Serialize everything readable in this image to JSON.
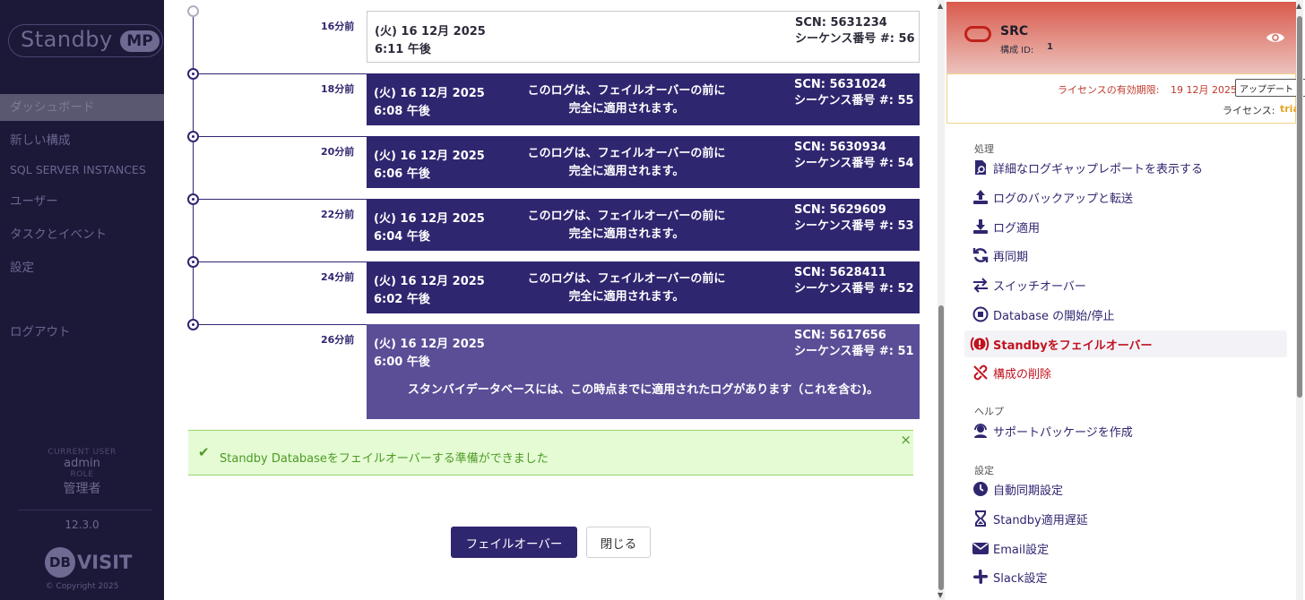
{
  "sidebar": {
    "logo_text": "Standby",
    "logo_badge": "MP",
    "nav": [
      {
        "label": "ダッシュボード"
      },
      {
        "label": "新しい構成"
      },
      {
        "label": "SQL SERVER INSTANCES"
      },
      {
        "label": "ユーザー"
      },
      {
        "label": "タスクとイベント"
      },
      {
        "label": "設定"
      },
      {
        "label": "ログアウト"
      }
    ],
    "current_user_label": "CURRENT USER",
    "current_user": "admin",
    "role_label": "ROLE",
    "role": "管理者",
    "version": "12.3.0",
    "brand_mark": "DB",
    "brand_text": "VISIT",
    "copyright": "© Copyright 2025"
  },
  "timeline": {
    "entries": [
      {
        "ago": "16分前",
        "date": "(火) 16 12月 2025",
        "time": "6:11 午後",
        "note": "",
        "scn": "SCN: 5631234",
        "seq": "シーケンス番号 #: 56",
        "style": "plain"
      },
      {
        "ago": "18分前",
        "date": "(火) 16 12月 2025",
        "time": "6:08 午後",
        "note1": "このログは、フェイルオーバーの前に",
        "note2": "完全に適用されます。",
        "scn": "SCN: 5631024",
        "seq": "シーケンス番号 #: 55",
        "style": "dark"
      },
      {
        "ago": "20分前",
        "date": "(火) 16 12月 2025",
        "time": "6:06 午後",
        "note1": "このログは、フェイルオーバーの前に",
        "note2": "完全に適用されます。",
        "scn": "SCN: 5630934",
        "seq": "シーケンス番号 #: 54",
        "style": "dark"
      },
      {
        "ago": "22分前",
        "date": "(火) 16 12月 2025",
        "time": "6:04 午後",
        "note1": "このログは、フェイルオーバーの前に",
        "note2": "完全に適用されます。",
        "scn": "SCN: 5629609",
        "seq": "シーケンス番号 #: 53",
        "style": "dark"
      },
      {
        "ago": "24分前",
        "date": "(火) 16 12月 2025",
        "time": "6:02 午後",
        "note1": "このログは、フェイルオーバーの前に",
        "note2": "完全に適用されます。",
        "scn": "SCN: 5628411",
        "seq": "シーケンス番号 #: 52",
        "style": "dark"
      },
      {
        "ago": "26分前",
        "date": "(火) 16 12月 2025",
        "time": "6:00 午後",
        "scn": "SCN: 5617656",
        "seq": "シーケンス番号 #: 51",
        "footer": "スタンバイデータベースには、この時点までに適用されたログがあります（これを含む)。",
        "style": "light"
      }
    ]
  },
  "alert": {
    "message": "Standby Databaseをフェイルオーバーする準備ができました",
    "close": "×"
  },
  "buttons": {
    "failover": "フェイルオーバー",
    "close": "閉じる"
  },
  "panel": {
    "name": "SRC",
    "config_id_label": "構成 ID:",
    "config_id": "1",
    "license_expiry_label": "ライセンスの有効期限:",
    "license_expiry": "19 12月 2025",
    "update_button": "アップデート",
    "license_label": "ライセンス:",
    "license_type": "tria",
    "sections": {
      "process": "処理",
      "help": "ヘルプ",
      "settings": "設定"
    },
    "actions": [
      {
        "label": "詳細なログギャップレポートを表示する"
      },
      {
        "label": "ログのバックアップと転送"
      },
      {
        "label": "ログ適用"
      },
      {
        "label": "再同期"
      },
      {
        "label": "スイッチオーバー"
      },
      {
        "label": "Database の開始/停止"
      },
      {
        "label": "Standbyをフェイルオーバー"
      },
      {
        "label": "構成の削除"
      }
    ],
    "help_actions": [
      {
        "label": "サポートパッケージを作成"
      }
    ],
    "settings_actions": [
      {
        "label": "自動同期設定"
      },
      {
        "label": "Standby適用遅延"
      },
      {
        "label": "Email設定"
      },
      {
        "label": "Slack設定"
      }
    ]
  },
  "colors": {
    "brand": "#2f2670",
    "sidebar_bg": "#1c1838",
    "danger": "#c1121f",
    "success": "#4d9a24"
  }
}
